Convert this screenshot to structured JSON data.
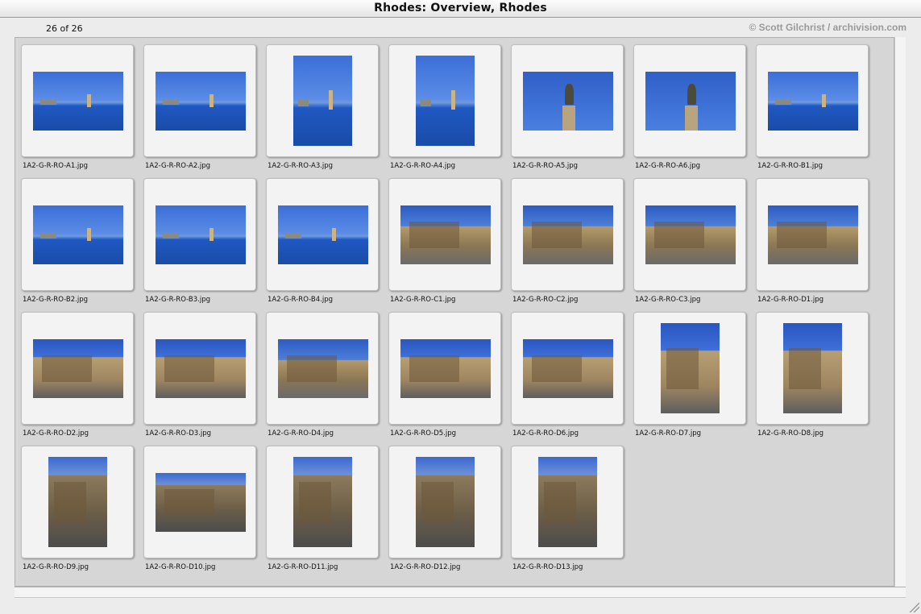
{
  "window": {
    "title": "Rhodes: Overview, Rhodes",
    "count_label": "26 of 26",
    "credit": "© Scott Gilchrist / archivision.com"
  },
  "thumbnails": [
    {
      "filename": "1A2-G-R-RO-A1.jpg",
      "orientation": "landscape",
      "scene": "sea"
    },
    {
      "filename": "1A2-G-R-RO-A2.jpg",
      "orientation": "landscape",
      "scene": "sea"
    },
    {
      "filename": "1A2-G-R-RO-A3.jpg",
      "orientation": "portrait",
      "scene": "sea"
    },
    {
      "filename": "1A2-G-R-RO-A4.jpg",
      "orientation": "portrait",
      "scene": "sea"
    },
    {
      "filename": "1A2-G-R-RO-A5.jpg",
      "orientation": "landscape",
      "scene": "sky"
    },
    {
      "filename": "1A2-G-R-RO-A6.jpg",
      "orientation": "landscape",
      "scene": "sky"
    },
    {
      "filename": "1A2-G-R-RO-B1.jpg",
      "orientation": "landscape",
      "scene": "sea"
    },
    {
      "filename": "1A2-G-R-RO-B2.jpg",
      "orientation": "landscape",
      "scene": "sea"
    },
    {
      "filename": "1A2-G-R-RO-B3.jpg",
      "orientation": "landscape",
      "scene": "sea"
    },
    {
      "filename": "1A2-G-R-RO-B4.jpg",
      "orientation": "landscape",
      "scene": "sea"
    },
    {
      "filename": "1A2-G-R-RO-C1.jpg",
      "orientation": "landscape",
      "scene": "town"
    },
    {
      "filename": "1A2-G-R-RO-C2.jpg",
      "orientation": "landscape",
      "scene": "town"
    },
    {
      "filename": "1A2-G-R-RO-C3.jpg",
      "orientation": "landscape",
      "scene": "town"
    },
    {
      "filename": "1A2-G-R-RO-D1.jpg",
      "orientation": "landscape",
      "scene": "town"
    },
    {
      "filename": "1A2-G-R-RO-D2.jpg",
      "orientation": "landscape",
      "scene": "stone"
    },
    {
      "filename": "1A2-G-R-RO-D3.jpg",
      "orientation": "landscape",
      "scene": "stone"
    },
    {
      "filename": "1A2-G-R-RO-D4.jpg",
      "orientation": "landscape",
      "scene": "town"
    },
    {
      "filename": "1A2-G-R-RO-D5.jpg",
      "orientation": "landscape",
      "scene": "stone"
    },
    {
      "filename": "1A2-G-R-RO-D6.jpg",
      "orientation": "landscape",
      "scene": "stone"
    },
    {
      "filename": "1A2-G-R-RO-D7.jpg",
      "orientation": "portrait",
      "scene": "stone"
    },
    {
      "filename": "1A2-G-R-RO-D8.jpg",
      "orientation": "portrait",
      "scene": "stone"
    },
    {
      "filename": "1A2-G-R-RO-D9.jpg",
      "orientation": "portrait",
      "scene": "street"
    },
    {
      "filename": "1A2-G-R-RO-D10.jpg",
      "orientation": "landscape",
      "scene": "street"
    },
    {
      "filename": "1A2-G-R-RO-D11.jpg",
      "orientation": "portrait",
      "scene": "street"
    },
    {
      "filename": "1A2-G-R-RO-D12.jpg",
      "orientation": "portrait",
      "scene": "street"
    },
    {
      "filename": "1A2-G-R-RO-D13.jpg",
      "orientation": "portrait",
      "scene": "street"
    }
  ]
}
